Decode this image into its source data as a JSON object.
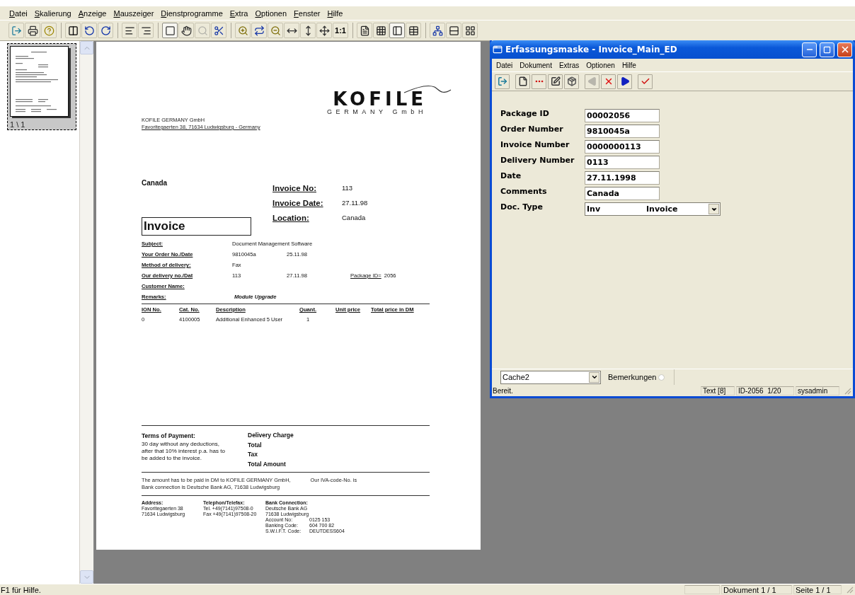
{
  "menu": [
    "Datei",
    "Skalierung",
    "Anzeige",
    "Mauszeiger",
    "Dienstprogramme",
    "Extra",
    "Optionen",
    "Fenster",
    "Hilfe"
  ],
  "toolbar": {
    "groups": [
      {
        "buttons": [
          {
            "kind": "exit",
            "pressed": false,
            "disabled": false
          },
          {
            "kind": "print",
            "pressed": false,
            "disabled": false
          },
          {
            "kind": "help",
            "pressed": false,
            "disabled": false
          }
        ]
      },
      {
        "buttons": [
          {
            "kind": "panels",
            "pressed": false,
            "disabled": false
          },
          {
            "kind": "rotate-left",
            "pressed": false,
            "disabled": false
          },
          {
            "kind": "rotate-right",
            "pressed": false,
            "disabled": false
          }
        ]
      },
      {
        "buttons": [
          {
            "kind": "lines-left",
            "pressed": false,
            "disabled": false
          },
          {
            "kind": "lines-right",
            "pressed": false,
            "disabled": false
          }
        ]
      },
      {
        "buttons": [
          {
            "kind": "select",
            "pressed": true,
            "disabled": false
          },
          {
            "kind": "hand",
            "pressed": false,
            "disabled": false
          },
          {
            "kind": "magnifier",
            "pressed": false,
            "disabled": true
          },
          {
            "kind": "cut",
            "pressed": false,
            "disabled": false
          }
        ]
      },
      {
        "buttons": [
          {
            "kind": "zoom-in",
            "pressed": false,
            "disabled": false
          },
          {
            "kind": "zoom-fit",
            "pressed": false,
            "disabled": false
          },
          {
            "kind": "zoom-out",
            "pressed": false,
            "disabled": false
          },
          {
            "kind": "fit-width",
            "pressed": false,
            "disabled": false
          },
          {
            "kind": "fit-height",
            "pressed": false,
            "disabled": false
          },
          {
            "kind": "fit-page",
            "pressed": false,
            "disabled": false
          },
          {
            "kind": "text",
            "label": "1:1",
            "pressed": false,
            "disabled": false
          }
        ]
      },
      {
        "buttons": [
          {
            "kind": "page-view",
            "pressed": false,
            "disabled": false
          },
          {
            "kind": "grid",
            "pressed": false,
            "disabled": false
          },
          {
            "kind": "split-view",
            "pressed": true,
            "disabled": false
          },
          {
            "kind": "table",
            "pressed": false,
            "disabled": false
          }
        ]
      },
      {
        "buttons": [
          {
            "kind": "tree",
            "pressed": false,
            "disabled": false
          },
          {
            "kind": "rows",
            "pressed": false,
            "disabled": false
          },
          {
            "kind": "tiles",
            "pressed": false,
            "disabled": false
          }
        ]
      }
    ]
  },
  "thumbnail": {
    "label": "1 \\ 1",
    "selected": true
  },
  "document": {
    "logo": {
      "name": "KOFILE",
      "sub": "GERMANY GmbH"
    },
    "sender": {
      "name": "KOFILE GERMANY GmbH",
      "address": "Favoritegaerten 38, 71634 Ludwigsburg - Germany"
    },
    "recipient_country": "Canada",
    "meta": [
      {
        "label": "Invoice No:",
        "value": "113"
      },
      {
        "label": "Invoice Date:",
        "value": "27.11.98"
      },
      {
        "label": "Location:",
        "value": "Canada"
      }
    ],
    "title": "Invoice",
    "details": [
      {
        "label": "Subject:",
        "values": [
          "Document Management Software"
        ],
        "kind": "plain"
      },
      {
        "label": "Your Order No./Date",
        "values": [
          "9810045a",
          "25.11.98"
        ],
        "kind": "plain"
      },
      {
        "label": "Method of delivery:",
        "values": [
          "Fax"
        ],
        "kind": "plain"
      },
      {
        "label": "Our delivery no./Dat",
        "values": [
          "113",
          "27.11.98"
        ],
        "extra_label": "Package ID=",
        "extra_value": "2056",
        "kind": "plain"
      },
      {
        "label": "Customer Name:",
        "kind": "plain"
      },
      {
        "label": "Remarks:",
        "values": [
          "Module Upgrade"
        ],
        "kind": "remark"
      }
    ],
    "table": {
      "columns": [
        "ION No.",
        "Cat. No.",
        "Description",
        "Quant.",
        "Unit price",
        "Total price in DM"
      ],
      "rows": [
        [
          "0",
          "4100005",
          "Additional Enhanced 5 User",
          "1"
        ]
      ]
    },
    "terms": {
      "title": "Terms of Payment:",
      "text": "30 day without any deductions, after that 10% interest p.a. has to be added to the invoice."
    },
    "totals": [
      "Delivery Charge",
      "Total",
      "Tax",
      "Total Amount"
    ],
    "note": [
      "The amount has to be paid in DM to KOFILE GERMANY GmbH,",
      "Bank connection is Deutsche Bank AG, 71638 Ludwigsburg"
    ],
    "note_right": "Our IVA-code-No. is",
    "footer": [
      {
        "title": "Address:",
        "lines": [
          "Favoritegaerten 38",
          "71634 Ludwigsburg"
        ]
      },
      {
        "title": "Telephon/Telefax:",
        "lines": [
          "Tel. +49(7141)97508-0",
          "Fax +49(7141)97508-20"
        ]
      },
      {
        "title": "Bank Connection:",
        "lines": [
          "Deutsche Bank AG",
          "71638 Ludwigsburg"
        ],
        "pairs": [
          [
            "Account No:",
            "0125 153"
          ],
          [
            "Banking Code:",
            "604 700 82"
          ],
          [
            "S.W.I.F.T. Code:",
            "DEUTDESS604"
          ]
        ]
      }
    ]
  },
  "status_bar": {
    "help": "F1 für Hilfe.",
    "document": "Dokument 1 / 1",
    "page": "Seite 1 / 1"
  },
  "window": {
    "title": "Erfassungsmaske - Invoice_Main_ED",
    "menu": [
      "Datei",
      "Dokument",
      "Extras",
      "Optionen",
      "Hilfe"
    ],
    "toolbar": [
      {
        "kind": "exit",
        "disabled": false
      },
      {
        "kind": "page",
        "disabled": false
      },
      {
        "kind": "more",
        "disabled": false
      },
      {
        "kind": "edit",
        "disabled": false
      },
      {
        "kind": "route",
        "disabled": false
      },
      {
        "kind": "previous",
        "disabled": true
      },
      {
        "kind": "delete",
        "disabled": false
      },
      {
        "kind": "next",
        "disabled": false
      },
      {
        "kind": "confirm",
        "disabled": false
      }
    ],
    "fields": [
      {
        "label": "Package ID",
        "value": "00002056"
      },
      {
        "label": "Order Number",
        "value": "9810045a"
      },
      {
        "label": "Invoice Number",
        "value": "0000000113"
      },
      {
        "label": "Delivery Number",
        "value": "0113"
      },
      {
        "label": "Date",
        "value": "27.11.1998"
      },
      {
        "label": "Comments",
        "value": "Canada"
      }
    ],
    "doc_type": {
      "label": "Doc. Type",
      "code": "Inv",
      "name": "Invoice"
    },
    "cache": "Cache2",
    "remarks": {
      "label": "Bemerkungen",
      "selected": false
    },
    "status": {
      "text": "Bereit.",
      "panels": [
        "Text [8]",
        "ID-2056  1/20",
        "sysadmin"
      ]
    }
  }
}
